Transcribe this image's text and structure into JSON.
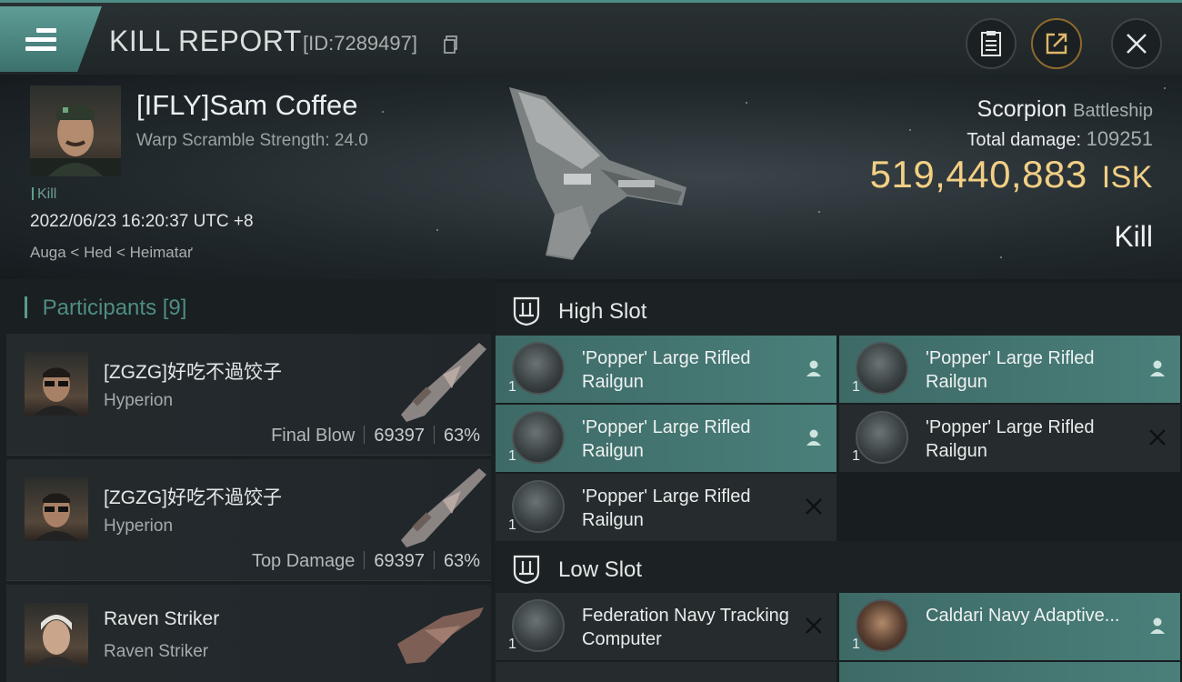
{
  "header": {
    "title": "KILL REPORT",
    "report_id": "[ID:7289497]"
  },
  "victim": {
    "name": "[IFLY]Sam Coffee",
    "subtitle": "Warp Scramble Strength: 24.0",
    "kill_tag": "Kill",
    "date": "2022/06/23 16:20:37 UTC +8",
    "location": "Auga < Hed < Heimatar",
    "ship_name": "Scorpion",
    "ship_class": "Battleship",
    "damage_label": "Total damage:",
    "damage_value": "109251",
    "isk_value": "519,440,883",
    "isk_unit": "ISK",
    "result": "Kill"
  },
  "participants": {
    "label": "Participants",
    "count": "[9]",
    "rows": [
      {
        "name": "[ZGZG]好吃不過饺子",
        "ship": "Hyperion",
        "tag": "Final Blow",
        "damage": "69397",
        "percent": "63%"
      },
      {
        "name": "[ZGZG]好吃不過饺子",
        "ship": "Hyperion",
        "tag": "Top Damage",
        "damage": "69397",
        "percent": "63%"
      },
      {
        "name": "Raven Striker",
        "ship": "Raven Striker",
        "tag": "",
        "damage": "",
        "percent": ""
      }
    ]
  },
  "fitting": {
    "high_slot": {
      "title": "High Slot",
      "modules": [
        {
          "name": "'Popper' Large Rifled Railgun",
          "qty": "1",
          "status": "dropped"
        },
        {
          "name": "'Popper' Large Rifled Railgun",
          "qty": "1",
          "status": "dropped"
        },
        {
          "name": "'Popper' Large Rifled Railgun",
          "qty": "1",
          "status": "dropped"
        },
        {
          "name": "'Popper' Large Rifled Railgun",
          "qty": "1",
          "status": "destroyed"
        },
        {
          "name": "'Popper' Large Rifled Railgun",
          "qty": "1",
          "status": "destroyed"
        }
      ]
    },
    "low_slot": {
      "title": "Low Slot",
      "modules": [
        {
          "name": "Federation Navy Tracking Computer",
          "qty": "1",
          "status": "destroyed"
        },
        {
          "name": "Caldari Navy Adaptive...",
          "qty": "1",
          "status": "dropped"
        }
      ]
    }
  },
  "colors": {
    "accent": "#4f8d85",
    "isk": "#f2cf84",
    "dropped": "#4a7f7a",
    "destroyed": "#262c2e"
  },
  "icons": {
    "menu": "hamburger-icon",
    "copy": "copy-icon",
    "clipboard": "clipboard-icon",
    "share": "share-icon",
    "close": "close-icon",
    "slot": "turret-slot-icon",
    "dropped": "person-icon",
    "destroyed": "x-icon"
  }
}
